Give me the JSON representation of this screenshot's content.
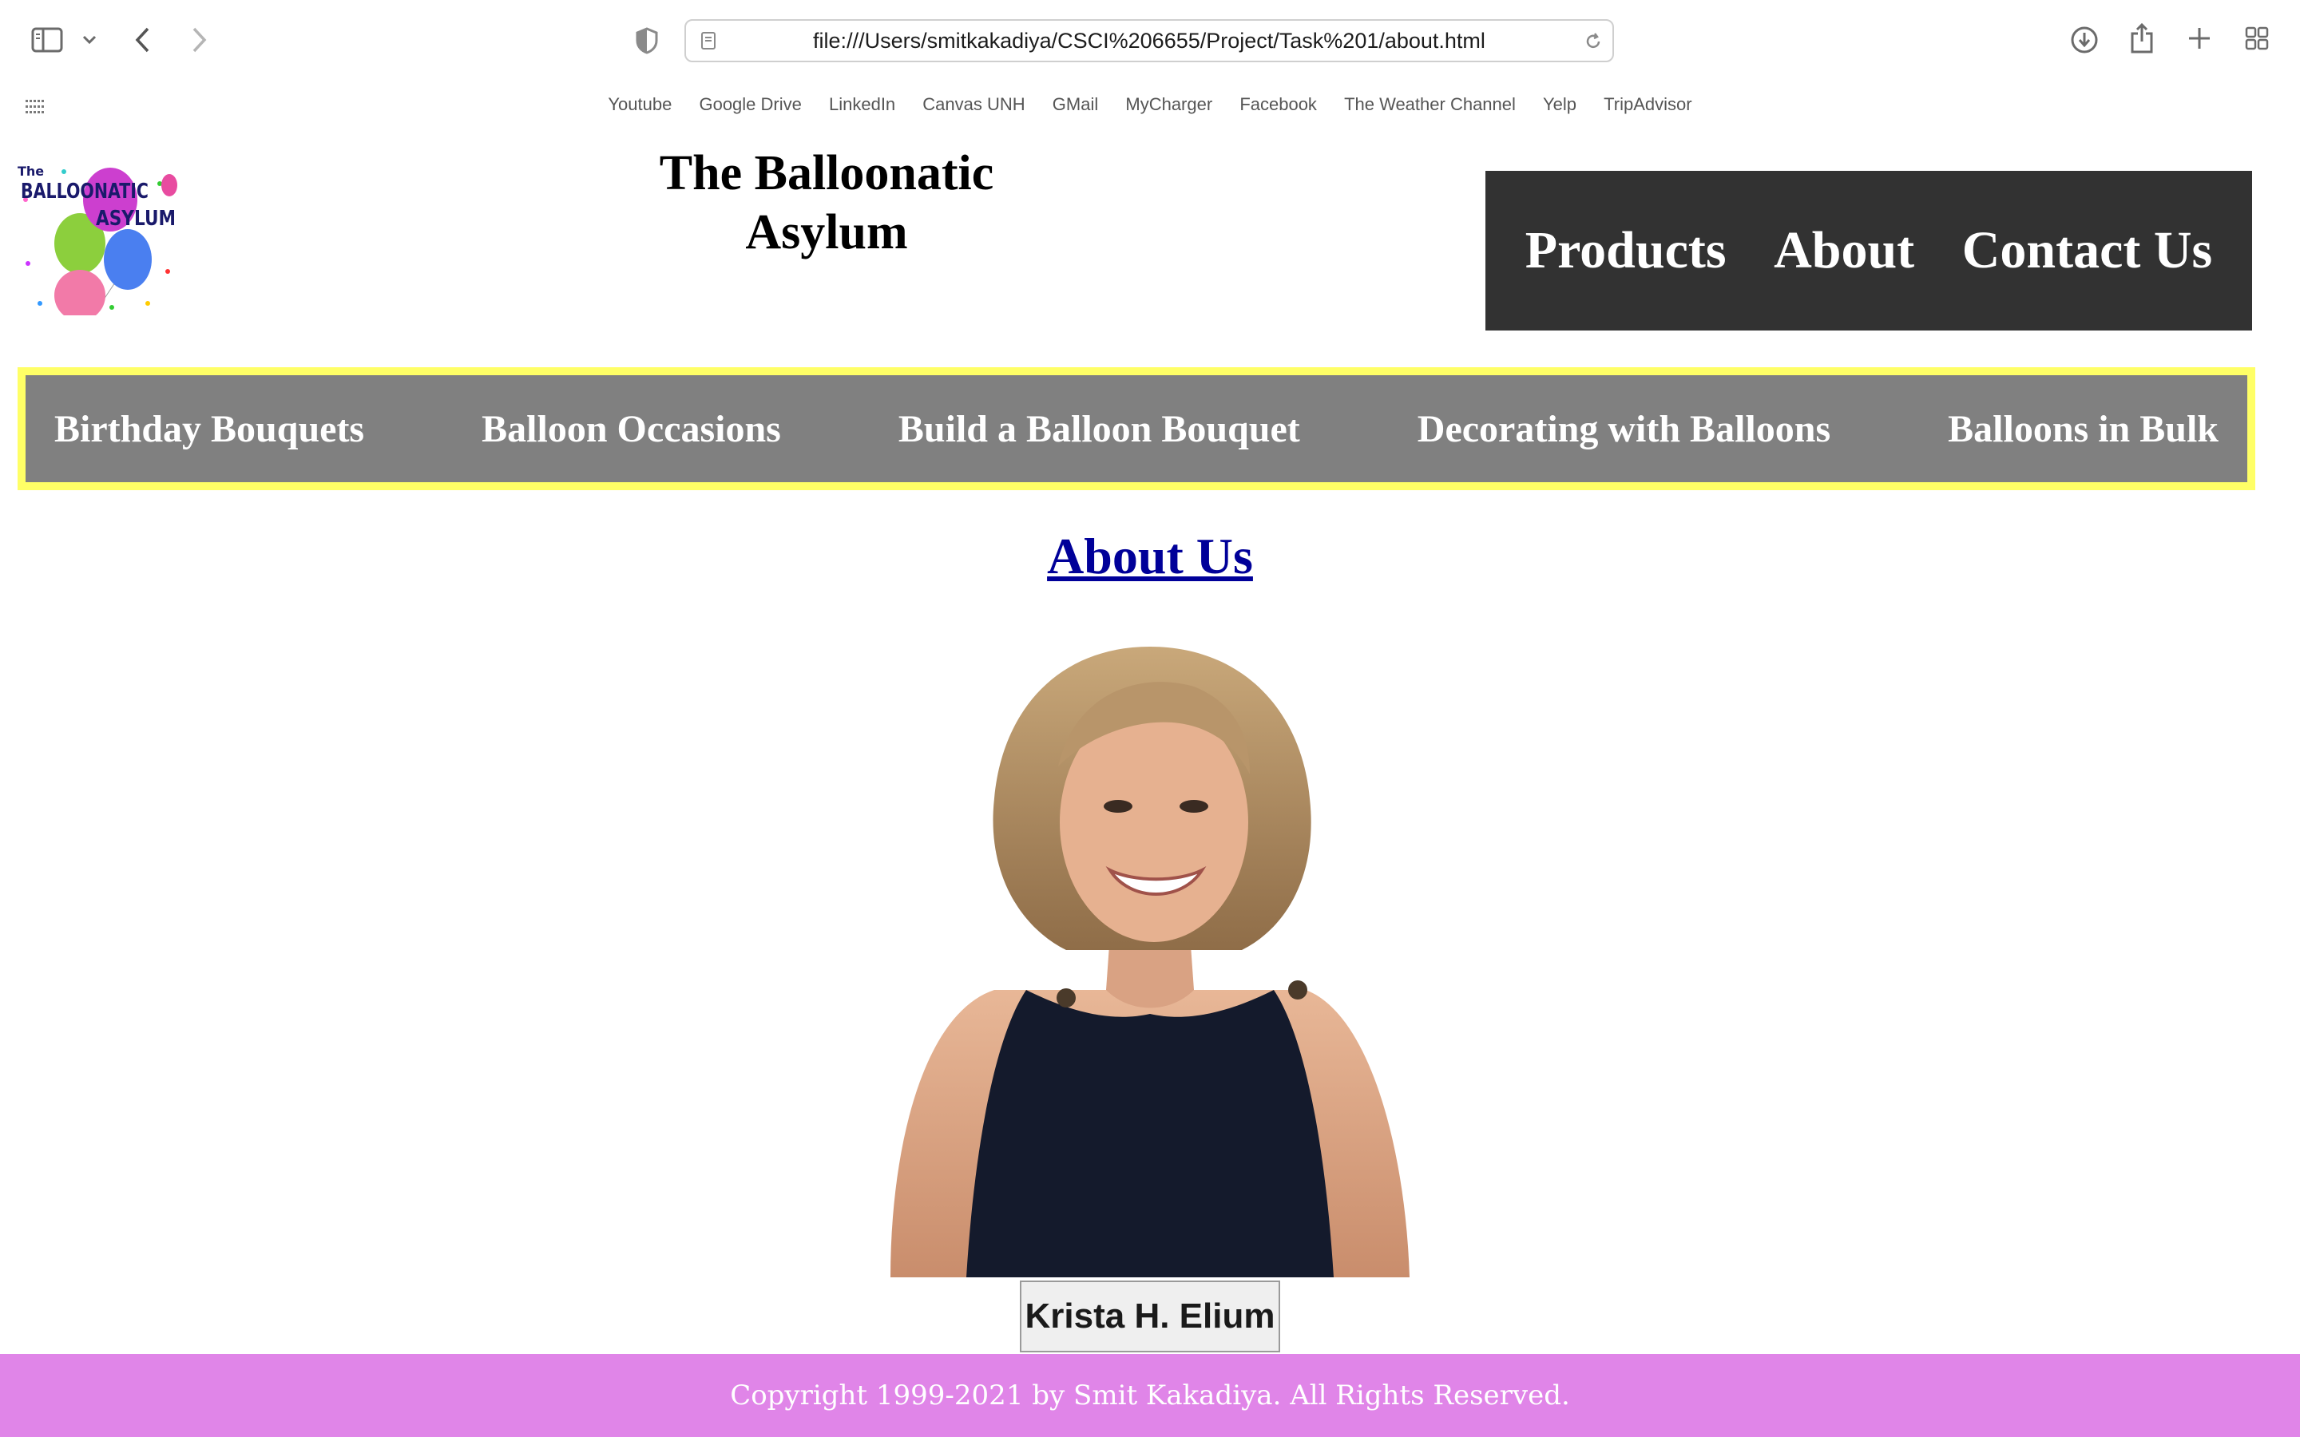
{
  "browser": {
    "url": "file:///Users/smitkakadiya/CSCI%206655/Project/Task%201/about.html",
    "favorites": [
      "Youtube",
      "Google Drive",
      "LinkedIn",
      "Canvas UNH",
      "GMail",
      "MyCharger",
      "Facebook",
      "The Weather Channel",
      "Yelp",
      "TripAdvisor"
    ]
  },
  "header": {
    "logo_text_1": "The",
    "logo_text_2": "BALLOONATIC",
    "logo_text_3": "ASYLUM",
    "title": "The Balloonatic Asylum"
  },
  "topnav": [
    "Products",
    "About",
    "Contact Us"
  ],
  "catnav": [
    "Birthday Bouquets",
    "Balloon Occasions",
    "Build a Balloon Bouquet",
    "Decorating with Balloons",
    "Balloons in Bulk"
  ],
  "main": {
    "heading": "About Us",
    "person_name": "Krista H. Elium"
  },
  "footer": {
    "text": "Copyright 1999-2021 by Smit Kakadiya. All Rights Reserved."
  },
  "colors": {
    "topnav_bg": "#323232",
    "catnav_bg": "#808080",
    "catnav_border": "#ffff66",
    "footer_bg": "#e085e8",
    "heading_link": "#000099"
  }
}
